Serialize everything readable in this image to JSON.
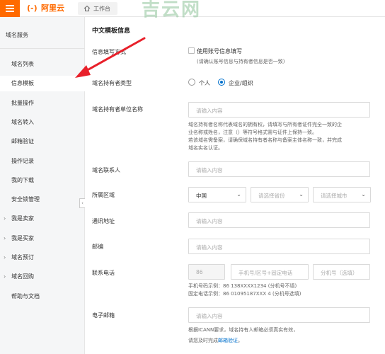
{
  "topbar": {
    "logo_mark": "(-)",
    "logo_text": "阿里云",
    "workbench_label": "工作台",
    "watermark": "吉云网"
  },
  "sidebar": {
    "title": "域名服务",
    "items": [
      {
        "label": "域名列表",
        "chevron": false,
        "active": false
      },
      {
        "label": "信息模板",
        "chevron": false,
        "active": true
      },
      {
        "label": "批量操作",
        "chevron": false,
        "active": false
      },
      {
        "label": "域名转入",
        "chevron": false,
        "active": false
      },
      {
        "label": "邮箱验证",
        "chevron": false,
        "active": false
      },
      {
        "label": "操作记录",
        "chevron": false,
        "active": false
      },
      {
        "label": "我的下载",
        "chevron": false,
        "active": false
      },
      {
        "label": "安全锁管理",
        "chevron": false,
        "active": false
      },
      {
        "label": "我是卖家",
        "chevron": true,
        "active": false
      },
      {
        "label": "我是买家",
        "chevron": true,
        "active": false
      },
      {
        "label": "域名预订",
        "chevron": true,
        "active": false
      },
      {
        "label": "域名回购",
        "chevron": true,
        "active": false
      },
      {
        "label": "帮助与文档",
        "chevron": false,
        "active": false
      }
    ]
  },
  "form": {
    "section_title": "中文模板信息",
    "info_fill": {
      "label": "信息填写方式",
      "checkbox_label": "使用账号信息填写",
      "hint": "(请确认账号信息与持有者信息是否一致)"
    },
    "holder_type": {
      "label": "域名持有者类型",
      "option_personal": "个人",
      "option_company": "企业/组织",
      "selected": "企业/组织"
    },
    "org_name": {
      "label": "域名持有者单位名称",
      "placeholder": "请输入内容",
      "help_1": "域名持有者名称代表域名的拥有权，请填写与所有者证件完全一致的企",
      "help_2": "业名称或姓名，注意（）等符号格式需与证件上保持一致。",
      "help_3": "若该域名需备案，请确保域名持有者名称与备案主体名称一致，并完成",
      "help_4": "域名实名认证。"
    },
    "contact": {
      "label": "域名联系人",
      "placeholder": "请输入内容"
    },
    "region": {
      "label": "所属区域",
      "country": "中国",
      "province_placeholder": "请选择省份",
      "city_placeholder": "请选择城市"
    },
    "address": {
      "label": "通讯地址",
      "placeholder": "请输入内容"
    },
    "postcode": {
      "label": "邮编",
      "placeholder": "请输入内容"
    },
    "phone": {
      "label": "联系电话",
      "country_code": "86",
      "number_placeholder": "手机号/区号+固定电话",
      "ext_placeholder": "分机号（选填）",
      "example_mobile": "手机号码示例：86 138XXXX1234     (分机号不填)",
      "example_fixed": "固定电话示例：86 01095187XXX 4   (分机号选填)"
    },
    "email": {
      "label": "电子邮箱",
      "placeholder": "请输入内容",
      "help_1": "根据ICANN要求，域名持有人邮箱必须真实有效，",
      "help_2_prefix": "请您及时完成",
      "help_2_link": "邮箱验证",
      "help_2_suffix": "。"
    }
  },
  "colors": {
    "accent": "#ff6a00",
    "link": "#0070cc",
    "annotation_arrow": "#e8202a"
  }
}
